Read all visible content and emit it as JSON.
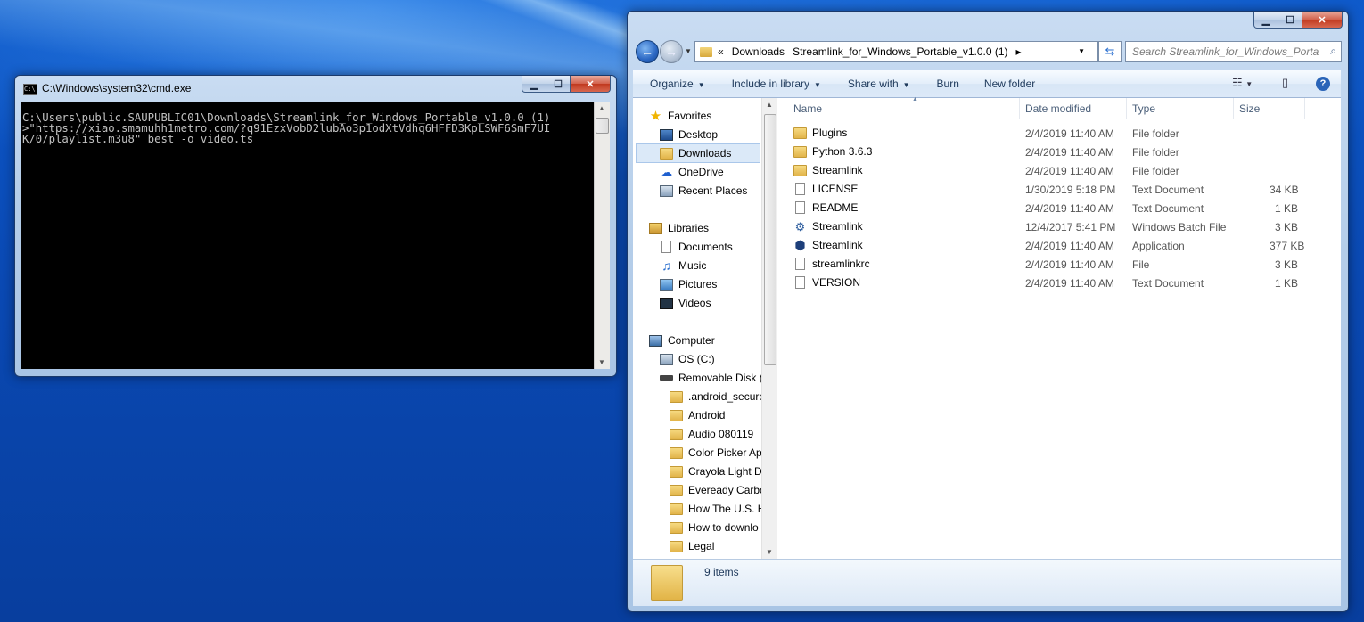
{
  "cmd": {
    "title": "C:\\Windows\\system32\\cmd.exe",
    "lines": [
      "C:\\Users\\public.SAUPUBLIC01\\Downloads\\Streamlink_for_Windows_Portable_v1.0.0 (1)",
      ">\"https://xiao.smamuhh1metro.com/?q91EzxVobD2lubAo3p1odXtVdhq6HFFD3KpLSWF6SmF7UI",
      "K/0/playlist.m3u8\" best -o video.ts"
    ]
  },
  "explorer": {
    "breadcrumb": [
      "«",
      "Downloads",
      "Streamlink_for_Windows_Portable_v1.0.0 (1)",
      "▸"
    ],
    "search_placeholder": "Search Streamlink_for_Windows_Portable_v1.0.0 (1)",
    "toolbar": {
      "organize": "Organize",
      "include": "Include in library",
      "share": "Share with",
      "burn": "Burn",
      "new_folder": "New folder"
    },
    "nav": {
      "favorites": "Favorites",
      "desktop": "Desktop",
      "downloads": "Downloads",
      "onedrive": "OneDrive",
      "recent": "Recent Places",
      "libraries": "Libraries",
      "documents": "Documents",
      "music": "Music",
      "pictures": "Pictures",
      "videos": "Videos",
      "computer": "Computer",
      "osc": "OS (C:)",
      "removable": "Removable Disk (",
      "sub": [
        ".android_secure",
        "Android",
        "Audio 080119",
        "Color Picker Ap",
        "Crayola Light D",
        "Eveready Carbo",
        "How The U.S. H",
        "How to downlo",
        "Legal"
      ]
    },
    "columns": {
      "name": "Name",
      "date": "Date modified",
      "type": "Type",
      "size": "Size"
    },
    "files": [
      {
        "name": "Plugins",
        "date": "2/4/2019 11:40 AM",
        "type": "File folder",
        "size": "",
        "icon": "folder"
      },
      {
        "name": "Python 3.6.3",
        "date": "2/4/2019 11:40 AM",
        "type": "File folder",
        "size": "",
        "icon": "folder"
      },
      {
        "name": "Streamlink",
        "date": "2/4/2019 11:40 AM",
        "type": "File folder",
        "size": "",
        "icon": "folder"
      },
      {
        "name": "LICENSE",
        "date": "1/30/2019 5:18 PM",
        "type": "Text Document",
        "size": "34 KB",
        "icon": "doc"
      },
      {
        "name": "README",
        "date": "2/4/2019 11:40 AM",
        "type": "Text Document",
        "size": "1 KB",
        "icon": "doc"
      },
      {
        "name": "Streamlink",
        "date": "12/4/2017 5:41 PM",
        "type": "Windows Batch File",
        "size": "3 KB",
        "icon": "gear"
      },
      {
        "name": "Streamlink",
        "date": "2/4/2019 11:40 AM",
        "type": "Application",
        "size": "377 KB",
        "icon": "app"
      },
      {
        "name": "streamlinkrc",
        "date": "2/4/2019 11:40 AM",
        "type": "File",
        "size": "3 KB",
        "icon": "doc"
      },
      {
        "name": "VERSION",
        "date": "2/4/2019 11:40 AM",
        "type": "Text Document",
        "size": "1 KB",
        "icon": "doc"
      }
    ],
    "status": "9 items"
  }
}
